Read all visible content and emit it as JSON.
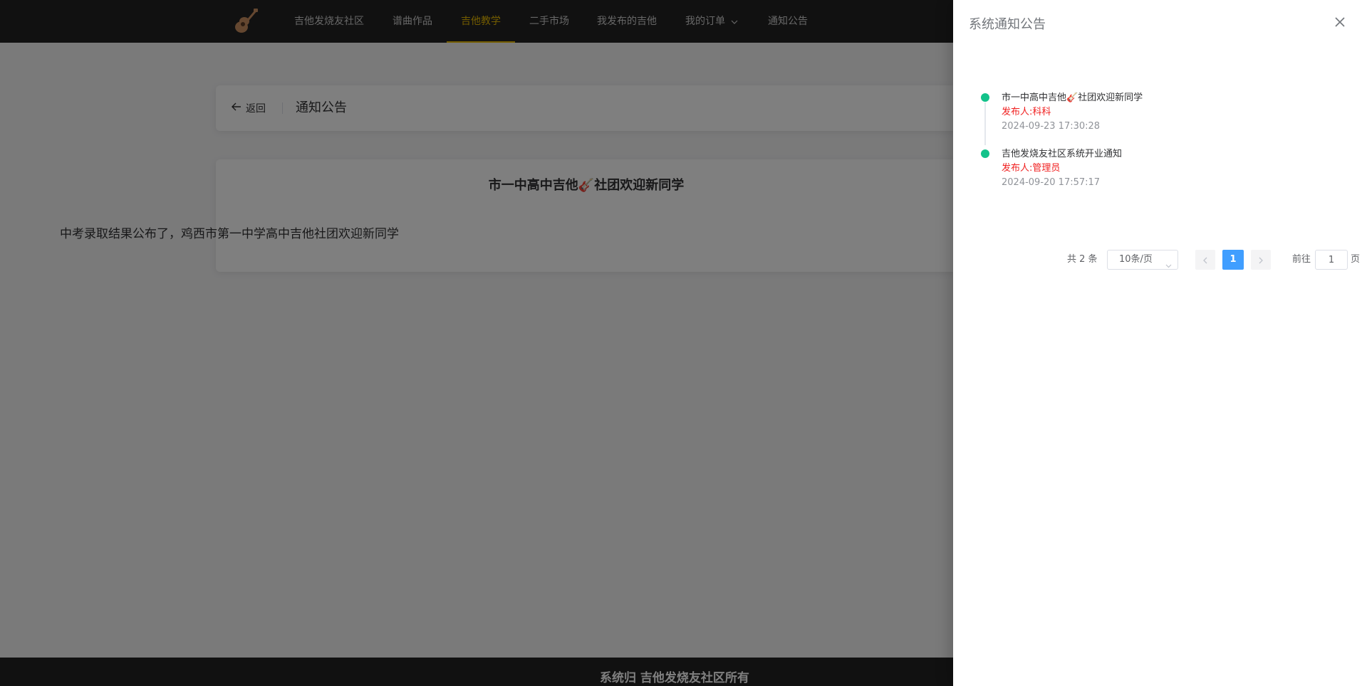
{
  "nav": {
    "items": [
      {
        "label": "吉他发烧友社区",
        "active": false
      },
      {
        "label": "谱曲作品",
        "active": false
      },
      {
        "label": "吉他教学",
        "active": true
      },
      {
        "label": "二手市场",
        "active": false
      },
      {
        "label": "我发布的吉他",
        "active": false
      },
      {
        "label": "我的订单",
        "active": false,
        "dropdown": true
      },
      {
        "label": "通知公告",
        "active": false
      }
    ],
    "active_color": "#e6b800"
  },
  "header": {
    "back_label": "返回",
    "title": "通知公告"
  },
  "notice": {
    "title": "市一中高中吉他🎸社团欢迎新同学",
    "body": "中考录取结果公布了，鸡西市第一中学高中吉他社团欢迎新同学"
  },
  "footer": {
    "text": "系统归 吉他发烧友社区所有"
  },
  "drawer": {
    "title": "系统通知公告",
    "items": [
      {
        "title": "市一中高中吉他🎸社团欢迎新同学",
        "author": "发布人:科科",
        "time": "2024-09-23 17:30:28"
      },
      {
        "title": "吉他发烧友社区系统开业通知",
        "author": "发布人:管理员",
        "time": "2024-09-20 17:57:17"
      }
    ],
    "dot_color": "#13c28a",
    "author_color": "#f02020"
  },
  "pagination": {
    "total": "共 2 条",
    "page_size": "10条/页",
    "current_page": "1",
    "goto_label": "前往",
    "goto_value": "1",
    "page_suffix": "页",
    "active_color": "#409eff"
  }
}
